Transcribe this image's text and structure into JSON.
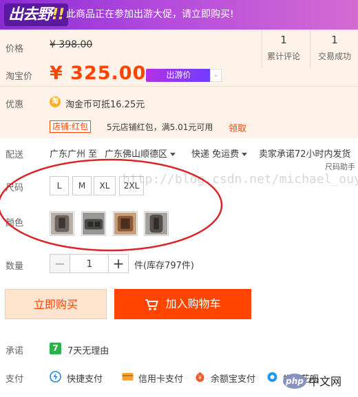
{
  "banner": {
    "logo": "出去野",
    "logo_bang": "!!",
    "text": "此商品正在参加出游大促，请立即购买!"
  },
  "price": {
    "label": "价格",
    "original": "¥ 398.00",
    "stats": [
      {
        "num": "1",
        "label": "累计评论"
      },
      {
        "num": "1",
        "label": "交易成功"
      }
    ],
    "promo_label": "淘宝价",
    "promo": "¥ 325.00",
    "promo_tag": "出游价",
    "tag_arrow": "⌄"
  },
  "offer": {
    "label": "优惠",
    "coin_icon": "淘",
    "coin_text": "淘金币可抵16.25元",
    "shop_tag": "店铺:红包",
    "redpack": "5元店铺红包，满5.01元可用",
    "claim": "领取"
  },
  "delivery": {
    "label": "配送",
    "from": "广东广州 至",
    "to": "广东佛山顺德区",
    "method": "快递 免运费",
    "promise": "卖家承诺72小时内发货"
  },
  "size_helper": "尺码助手",
  "size": {
    "label": "尺码",
    "options": [
      "L",
      "M",
      "XL",
      "2XL"
    ]
  },
  "color": {
    "label": "颜色",
    "swatch_colors": [
      "#6d6560",
      "#4a4a48",
      "#8a5a3a",
      "#55504c"
    ]
  },
  "watermark": "http://blog.csdn.net/michael_ouyang",
  "annotation_color": "#d9252a",
  "quantity": {
    "label": "数量",
    "minus": "−",
    "value": "1",
    "plus": "+",
    "stock": "件(库存797件)"
  },
  "actions": {
    "buy": "立即购买",
    "cart": "加入购物车"
  },
  "promise": {
    "label": "承诺",
    "icon": "7",
    "text": "7天无理由"
  },
  "payment": {
    "label": "支付",
    "methods": [
      "快捷支付",
      "信用卡支付",
      "余额宝支付",
      "蚂蚁花呗"
    ]
  },
  "site_logo": {
    "php": "php",
    "cn": "中文网"
  },
  "colors": {
    "accent": "#ff4400",
    "promo_bg": "#fff2e8",
    "banner_start": "#8b2bd6",
    "banner_end": "#d36bd2"
  }
}
